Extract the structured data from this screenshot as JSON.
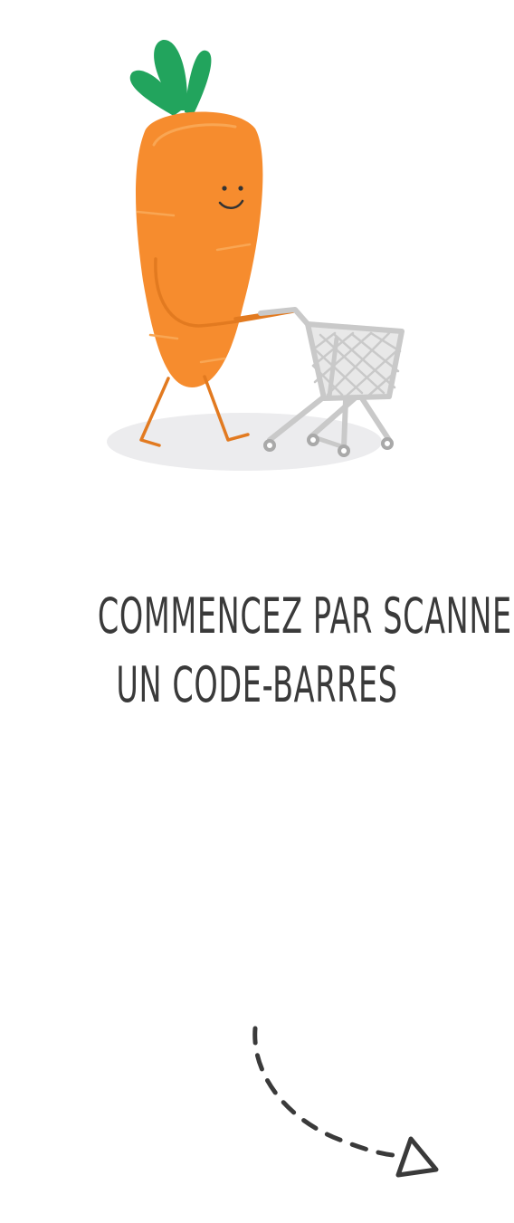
{
  "onboarding": {
    "headline_line_1": "COMMENCEZ PAR SCANNER",
    "headline_line_2": "UN CODE-BARRES"
  },
  "illustration": {
    "subject": "carrot-pushing-shopping-cart",
    "colors": {
      "carrot": "#F68C2E",
      "leaves": "#22A45D",
      "cart": "#C9C9C9",
      "shadow": "#ECECEE"
    }
  },
  "hint": {
    "icon": "dashed-arrow-icon",
    "color": "#3a3a3a"
  }
}
